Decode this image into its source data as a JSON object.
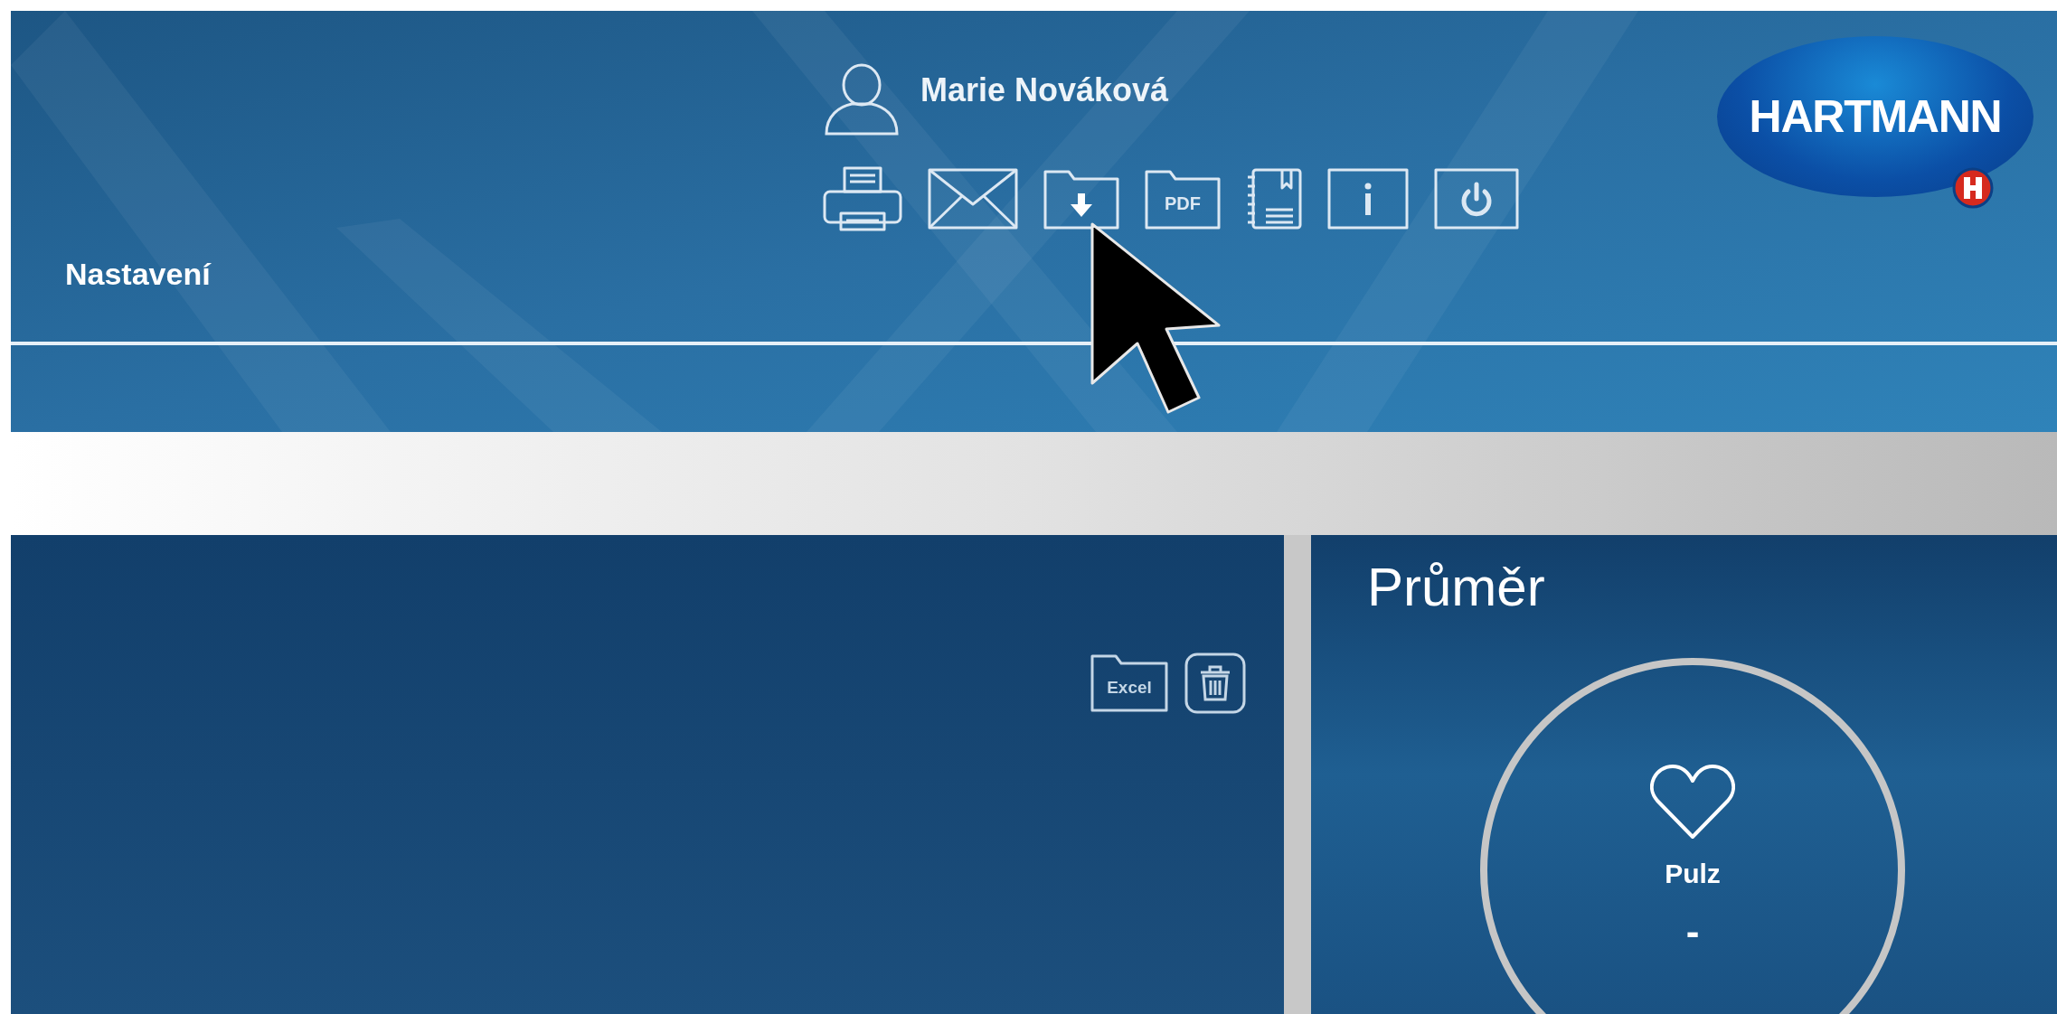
{
  "header": {
    "user_name": "Marie Nováková",
    "section_title": "Nastavení",
    "logo_text": "HARTMANN",
    "toolbar": [
      {
        "kind": "print"
      },
      {
        "kind": "mail"
      },
      {
        "kind": "download"
      },
      {
        "kind": "pdf",
        "label": "PDF"
      },
      {
        "kind": "notebook"
      },
      {
        "kind": "info"
      },
      {
        "kind": "power"
      }
    ]
  },
  "left_panel": {
    "tools": [
      {
        "kind": "excel",
        "label": "Excel"
      },
      {
        "kind": "trash"
      }
    ]
  },
  "right_panel": {
    "title": "Průměr",
    "gauge": {
      "label": "Pulz",
      "value": "-"
    }
  }
}
